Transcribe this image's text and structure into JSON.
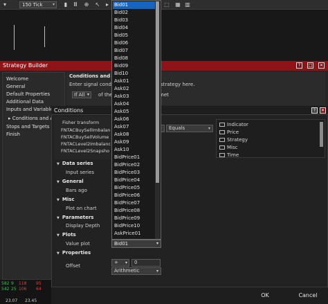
{
  "toolbar": {
    "period": "150 Tick"
  },
  "strategy_builder": {
    "title": "Strategy Builder",
    "nav": [
      "Welcome",
      "General",
      "Default Properties",
      "Additional Data",
      "Inputs and Variables",
      "Conditions and Act",
      "Stops and Targets",
      "Finish"
    ],
    "conditions_heading": "Conditions and Act",
    "instruction_left": "Enter signal conditi",
    "instruction_right": "strategy here.",
    "if_select": "If All",
    "of_the": "of the",
    "met": "met"
  },
  "conditions_dialog": {
    "title": "Conditions",
    "indicators": [
      "Fisher transform",
      "FNTACBuySellImbalan",
      "FNTACBuySellVolume",
      "FNTACLevel2Imbalanc",
      "FNTACLevel2Snapsho"
    ],
    "sections": [
      {
        "name": "Data series",
        "props": [
          "Input series"
        ]
      },
      {
        "name": "General",
        "props": [
          "Bars ago"
        ]
      },
      {
        "name": "Misc",
        "props": [
          "Plot on chart"
        ]
      },
      {
        "name": "Parameters",
        "props": [
          "Display Depth"
        ]
      },
      {
        "name": "Plots",
        "props": [
          "Value plot"
        ]
      },
      {
        "name": "Properties",
        "props": [
          "Offset"
        ]
      }
    ],
    "operator": "Equals",
    "categories": [
      "Indicator",
      "Price",
      "Strategy",
      "Misc",
      "Time"
    ],
    "value_plot": "Bid01",
    "offset_operator": "+",
    "offset_value": "0",
    "arithmetic": "Arithmetic",
    "ok": "OK",
    "cancel": "Cancel"
  },
  "dropdown": {
    "items": [
      "Bid01",
      "Bid02",
      "Bid03",
      "Bid04",
      "Bid05",
      "Bid06",
      "Bid07",
      "Bid08",
      "Bid09",
      "Bid10",
      "Ask01",
      "Ask02",
      "Ask03",
      "Ask04",
      "Ask05",
      "Ask06",
      "Ask07",
      "Ask08",
      "Ask09",
      "Ask10",
      "BidPrice01",
      "BidPrice02",
      "BidPrice03",
      "BidPrice04",
      "BidPrice05",
      "BidPrice06",
      "BidPrice07",
      "BidPrice08",
      "BidPrice09",
      "BidPrice10",
      "AskPrice01"
    ],
    "selected": "Bid01"
  },
  "ladder": {
    "rows": [
      [
        "582",
        "9",
        "118",
        "95"
      ],
      [
        "542",
        "25",
        "106",
        "64"
      ]
    ],
    "bottom": [
      "23.07",
      "23.45"
    ]
  },
  "colors": {
    "title_bar": "#8f1418",
    "selection": "#1565c0"
  }
}
